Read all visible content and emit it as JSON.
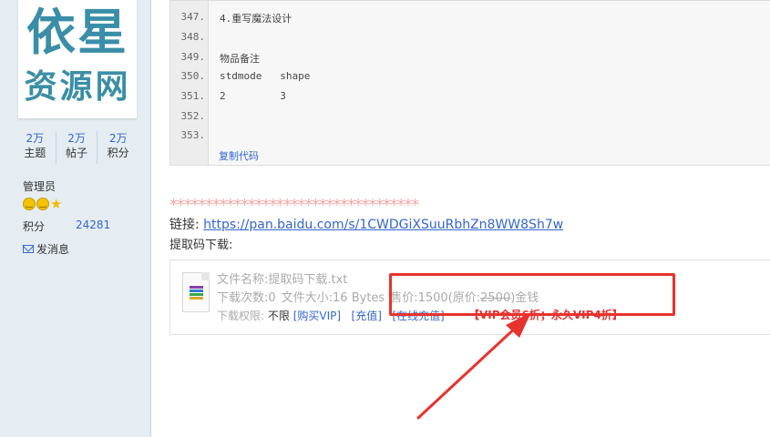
{
  "avatar": {
    "line1": "依星",
    "line2": "资源网"
  },
  "stats": [
    {
      "value": "2万",
      "label": "主题"
    },
    {
      "value": "2万",
      "label": "帖子"
    },
    {
      "value": "2万",
      "label": "积分"
    }
  ],
  "role": "管理员",
  "points": {
    "label": "积分",
    "value": "24281"
  },
  "send_message": "发消息",
  "code_block": {
    "lines": [
      {
        "num": "347.",
        "text": "4.重写魔法设计"
      },
      {
        "num": "348.",
        "text": ""
      },
      {
        "num": "349.",
        "text": "物品备注"
      },
      {
        "num": "350.",
        "text": "stdmode   shape"
      },
      {
        "num": "351.",
        "text": "2         3"
      },
      {
        "num": "352.",
        "text": ""
      },
      {
        "num": "353.",
        "text": ""
      }
    ],
    "copy_label": "复制代码"
  },
  "divider_stars": "***********************************",
  "link": {
    "label": "链接: ",
    "url": "https://pan.baidu.com/s/1CWDGiXSuuRbhZn8WW8Sh7w"
  },
  "code_download_title": "提取码下载:",
  "attachment": {
    "file_name": "文件名称:提取码下载.txt",
    "download_count": "下载次数:0",
    "file_size": "文件大小:16 Bytes",
    "price_prefix": "售价:1500(原价:",
    "original_price": "2500",
    "price_suffix": ")金钱",
    "permission_label": "下载权限: ",
    "permission_value": "不限",
    "buy_vip": "[购买VIP]",
    "recharge": "[充值]",
    "online_recharge": "[在线充值]",
    "vip_promo": "【VIP会员6折；永久VIP4折】"
  },
  "colors": {
    "accent": "#3366cc",
    "annotation": "#e8322d",
    "sidebar_bg": "#e5edf2",
    "vip_red": "#e03434"
  }
}
